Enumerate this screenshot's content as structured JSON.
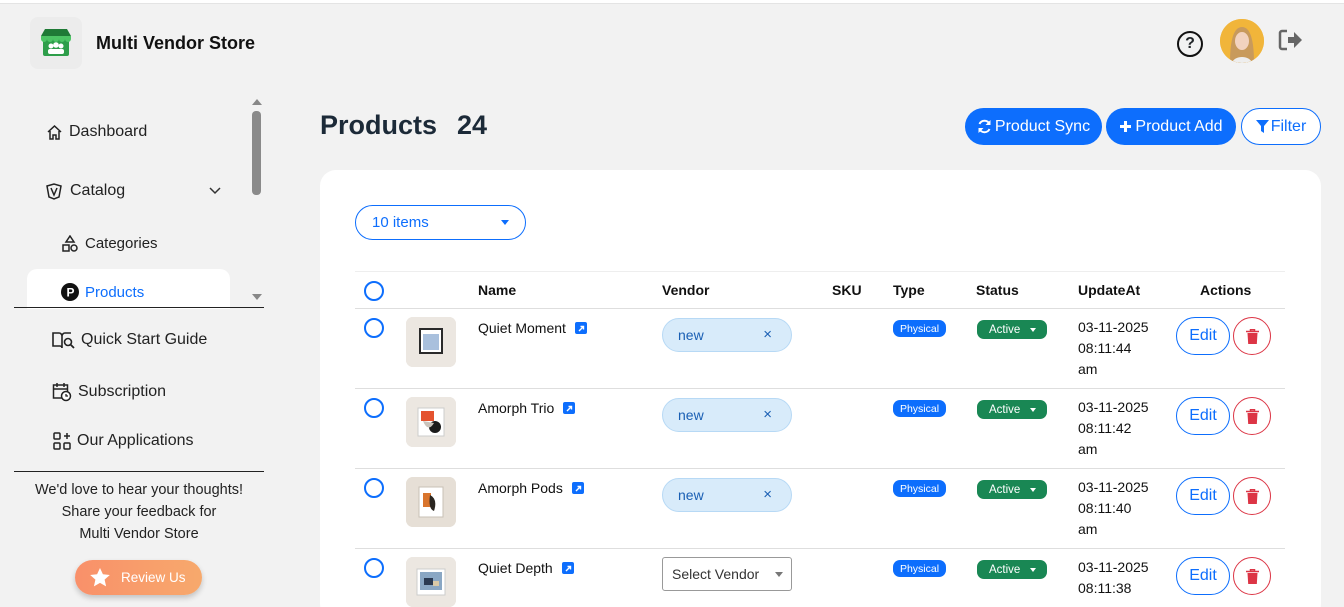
{
  "app": {
    "name": "Multi Vendor Store"
  },
  "sidebar": {
    "items": [
      {
        "label": "Dashboard",
        "icon": "home-icon"
      },
      {
        "label": "Catalog",
        "icon": "catalog-icon"
      },
      {
        "label": "Categories",
        "icon": "shapes-icon"
      },
      {
        "label": "Products",
        "icon": "product-p-icon"
      }
    ],
    "bottom_items": [
      {
        "label": "Quick Start Guide",
        "icon": "book-search-icon"
      },
      {
        "label": "Subscription",
        "icon": "calendar-clock-icon"
      },
      {
        "label": "Our Applications",
        "icon": "apps-grid-icon"
      }
    ],
    "feedback": {
      "line1": "We'd love to hear your thoughts!",
      "line2": "Share your feedback for",
      "line3": "Multi Vendor Store"
    },
    "review_label": "Review Us"
  },
  "main": {
    "title": "Products",
    "count": "24",
    "buttons": {
      "sync": "Product Sync",
      "add": "Product Add",
      "filter": "Filter"
    },
    "items_per_page": "10 items",
    "columns": [
      "Name",
      "Vendor",
      "SKU",
      "Type",
      "Status",
      "UpdateAt",
      "Actions"
    ],
    "rows": [
      {
        "name": "Quiet Moment",
        "vendor": "new",
        "type": "Physical",
        "status": "Active",
        "date": "03-11-2025",
        "time": "08:11:44",
        "ampm": "am"
      },
      {
        "name": "Amorph Trio",
        "vendor": "new",
        "type": "Physical",
        "status": "Active",
        "date": "03-11-2025",
        "time": "08:11:42",
        "ampm": "am"
      },
      {
        "name": "Amorph Pods",
        "vendor": "new",
        "type": "Physical",
        "status": "Active",
        "date": "03-11-2025",
        "time": "08:11:40",
        "ampm": "am"
      },
      {
        "name": "Quiet Depth",
        "vendor_placeholder": "Select Vendor",
        "type": "Physical",
        "status": "Active",
        "date": "03-11-2025",
        "time": "08:11:38"
      }
    ],
    "edit_label": "Edit",
    "remove_symbol": "×"
  },
  "colors": {
    "primary": "#0d6efd",
    "success": "#198754",
    "danger": "#dc3545",
    "review": "#f9906a"
  }
}
